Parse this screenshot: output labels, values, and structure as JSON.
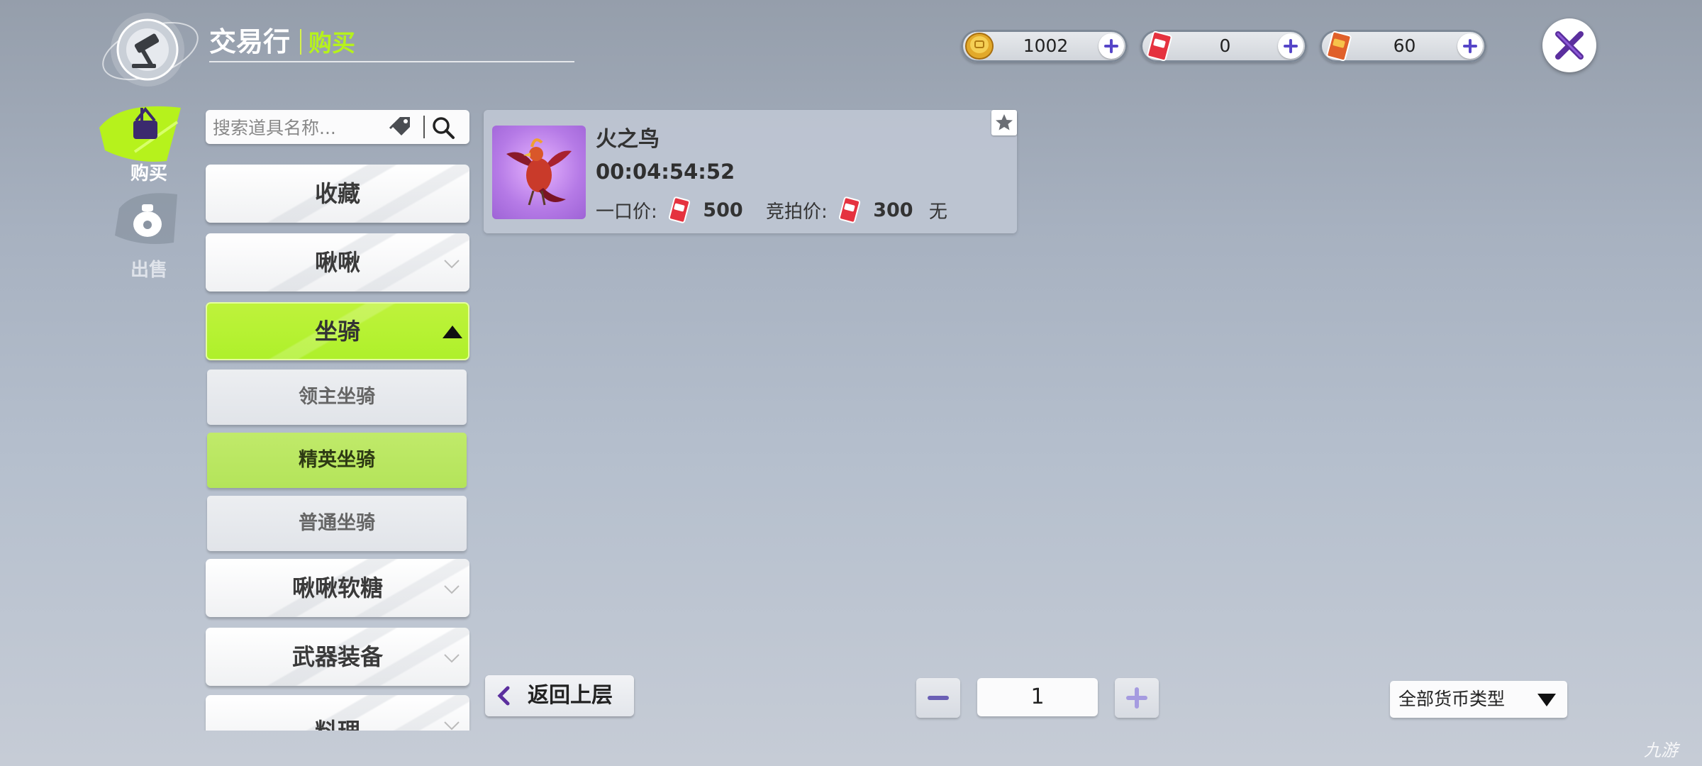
{
  "header": {
    "title": "交易行",
    "subtitle": "购买"
  },
  "currencies": [
    {
      "icon": "gold-coin-icon",
      "value": "1002"
    },
    {
      "icon": "red-ticket-icon",
      "value": "0"
    },
    {
      "icon": "orange-ticket-icon",
      "value": "60"
    }
  ],
  "sidebar": {
    "buy_label": "购买",
    "sell_label": "出售"
  },
  "search": {
    "placeholder": "搜索道具名称..."
  },
  "categories": [
    {
      "label": "收藏"
    },
    {
      "label": "啾啾"
    },
    {
      "label": "坐骑",
      "expanded": true
    },
    {
      "label": "领主坐骑",
      "sub": true
    },
    {
      "label": "精英坐骑",
      "sub": true,
      "selected": true
    },
    {
      "label": "普通坐骑",
      "sub": true
    },
    {
      "label": "啾啾软糖"
    },
    {
      "label": "武器装备"
    },
    {
      "label": "料理"
    }
  ],
  "item": {
    "name": "火之鸟",
    "timer": "00:04:54:52",
    "buyout_label": "一口价:",
    "buyout_value": "500",
    "bid_label": "竞拍价:",
    "bid_value": "300",
    "bid_extra": "无"
  },
  "bottom": {
    "back_label": "返回上层",
    "page_value": "1",
    "currency_filter": "全部货币类型"
  },
  "watermark": "九游",
  "colors": {
    "accent_green": "#b6f21c",
    "button_purple": "#5646c8"
  }
}
